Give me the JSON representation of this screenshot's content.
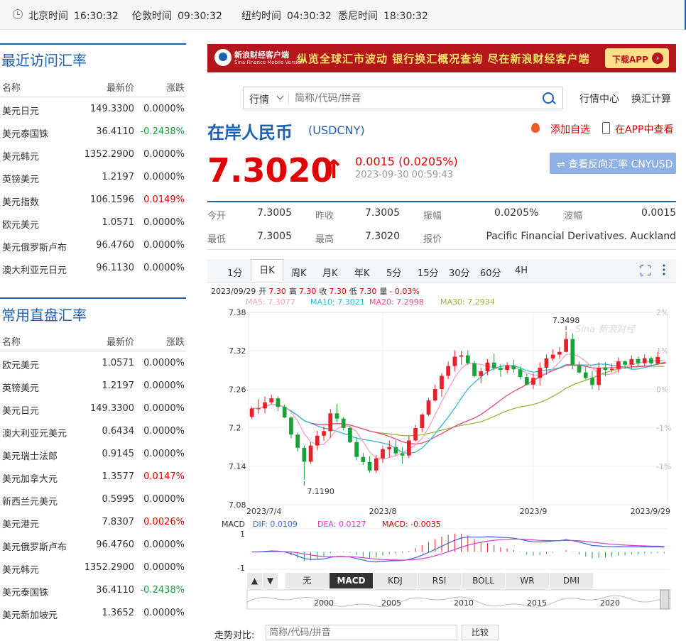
{
  "topbar": {
    "zones": [
      {
        "label": "北京时间",
        "time": "16:30:32"
      },
      {
        "label": "伦敦时间",
        "time": "09:30:32"
      },
      {
        "label": "纽约时间",
        "time": "04:30:32"
      },
      {
        "label": "悉尼时间",
        "time": "18:30:32"
      }
    ]
  },
  "recent": {
    "title": "最近访问汇率",
    "headers": [
      "名称",
      "最新价",
      "涨跌"
    ],
    "rows": [
      {
        "name": "美元日元",
        "price": "149.3300",
        "chg": "0.0000%",
        "dir": "flat"
      },
      {
        "name": "美元泰国铢",
        "price": "36.4110",
        "chg": "-0.2438%",
        "dir": "down"
      },
      {
        "name": "美元韩元",
        "price": "1352.2900",
        "chg": "0.0000%",
        "dir": "flat"
      },
      {
        "name": "英镑美元",
        "price": "1.2197",
        "chg": "0.0000%",
        "dir": "flat"
      },
      {
        "name": "美元指数",
        "price": "106.1596",
        "chg": "0.0149%",
        "dir": "up"
      },
      {
        "name": "欧元美元",
        "price": "1.0571",
        "chg": "0.0000%",
        "dir": "flat"
      },
      {
        "name": "美元俄罗斯卢布",
        "price": "96.4760",
        "chg": "0.0000%",
        "dir": "flat"
      },
      {
        "name": "澳大利亚元日元",
        "price": "96.1130",
        "chg": "0.0000%",
        "dir": "flat"
      }
    ]
  },
  "direct": {
    "title": "常用直盘汇率",
    "headers": [
      "名称",
      "最新价",
      "涨跌"
    ],
    "rows": [
      {
        "name": "欧元美元",
        "price": "1.0571",
        "chg": "0.0000%",
        "dir": "flat"
      },
      {
        "name": "英镑美元",
        "price": "1.2197",
        "chg": "0.0000%",
        "dir": "flat"
      },
      {
        "name": "美元日元",
        "price": "149.3300",
        "chg": "0.0000%",
        "dir": "flat"
      },
      {
        "name": "澳大利亚元美元",
        "price": "0.6434",
        "chg": "0.0000%",
        "dir": "flat"
      },
      {
        "name": "美元瑞士法郎",
        "price": "0.9145",
        "chg": "0.0000%",
        "dir": "flat"
      },
      {
        "name": "美元加拿大元",
        "price": "1.3577",
        "chg": "0.0147%",
        "dir": "up"
      },
      {
        "name": "新西兰元美元",
        "price": "0.5995",
        "chg": "0.0000%",
        "dir": "flat"
      },
      {
        "name": "美元港元",
        "price": "7.8307",
        "chg": "0.0026%",
        "dir": "up"
      },
      {
        "name": "美元俄罗斯卢布",
        "price": "96.4760",
        "chg": "0.0000%",
        "dir": "flat"
      },
      {
        "name": "美元韩元",
        "price": "1352.2900",
        "chg": "0.0000%",
        "dir": "flat"
      },
      {
        "name": "美元泰国铢",
        "price": "36.4110",
        "chg": "-0.2438%",
        "dir": "down"
      },
      {
        "name": "美元新加坡元",
        "price": "1.3652",
        "chg": "0.0000%",
        "dir": "flat"
      }
    ]
  },
  "banner": {
    "brand": "新浪财经客户端",
    "brand_en": "Sina Finance Mobile Version",
    "slogan": "纵览全球汇市波动 银行换汇概况查询 尽在新浪财经客户端",
    "download": "下载APP"
  },
  "search": {
    "select": "行情",
    "placeholder": "简称/代码/拼音",
    "links": [
      "行情中心",
      "换汇计算"
    ]
  },
  "quote": {
    "name": "在岸人民币",
    "code": "(USDCNY)",
    "add_watch": "添加自选",
    "view_app": "在APP中查看",
    "price": "7.3020",
    "arrow": "↑",
    "change": "0.0015 (0.0205%)",
    "time": "2023-09-30 00:59:43",
    "reverse_btn": "⇌ 查看反向汇率 CNYUSD",
    "stats": [
      {
        "k": "今开",
        "v": "7.3005"
      },
      {
        "k": "昨收",
        "v": "7.3005"
      },
      {
        "k": "振幅",
        "v": "0.0205%"
      },
      {
        "k": "波幅",
        "v": "0.0015"
      },
      {
        "k": "最低",
        "v": "7.3005"
      },
      {
        "k": "最高",
        "v": "7.3020"
      },
      {
        "k": "报价",
        "v": "Pacific Financial Derivatives. Auckland"
      }
    ]
  },
  "periods": [
    "1分",
    "日K",
    "周K",
    "月K",
    "年K",
    "5分",
    "15分",
    "30分",
    "60分",
    "4H"
  ],
  "active_period": "日K",
  "indicators": [
    "无",
    "MACD",
    "KDJ",
    "RSI",
    "BOLL",
    "WR",
    "DMI"
  ],
  "active_indicator": "MACD",
  "compare": {
    "label": "走势对比:",
    "placeholder": "简称/代码/拼音",
    "button": "比较"
  },
  "chart_data": {
    "type": "candlestick",
    "info_line": {
      "date": "2023/09/29",
      "items": [
        {
          "k": "开",
          "v": "7.30"
        },
        {
          "k": "高",
          "v": "7.30"
        },
        {
          "k": "收",
          "v": "7.30"
        },
        {
          "k": "低",
          "v": "7.30"
        },
        {
          "k": "量",
          "v": "- 0.03%"
        }
      ]
    },
    "ma": [
      {
        "name": "MA5",
        "value": "7.3077",
        "color": "#f4a0b8"
      },
      {
        "name": "MA10",
        "value": "7.3021",
        "color": "#2fb8d8"
      },
      {
        "name": "MA20",
        "value": "7.2998",
        "color": "#e8497a"
      },
      {
        "name": "MA30",
        "value": "7.2934",
        "color": "#9ab53a"
      }
    ],
    "y_ticks": [
      "7.38",
      "7.32",
      "7.26",
      "7.2",
      "7.14",
      "7.08"
    ],
    "pct_ticks": [
      "2%",
      "1%",
      "0%",
      "-1%",
      "-1%"
    ],
    "ylim": [
      7.08,
      7.38
    ],
    "x_labels": [
      {
        "label": "2023/7/4",
        "index": 0
      },
      {
        "label": "2023/8",
        "index": 20
      },
      {
        "label": "2023/9",
        "index": 43
      },
      {
        "label": "2023/9/29",
        "index": 63
      }
    ],
    "high_label": "7.3498",
    "low_label": "7.1190",
    "watermark": "Sina 新浪财经",
    "candles": [
      [
        7.2172,
        7.2322,
        7.2139,
        7.2301
      ],
      [
        7.2301,
        7.2445,
        7.2215,
        7.2301
      ],
      [
        7.2301,
        7.2489,
        7.2223,
        7.2397
      ],
      [
        7.2397,
        7.2513,
        7.237,
        7.2459
      ],
      [
        7.2459,
        7.2492,
        7.2258,
        7.2325
      ],
      [
        7.2325,
        7.2364,
        7.2149,
        7.216
      ],
      [
        7.216,
        7.218,
        7.1833,
        7.1893
      ],
      [
        7.1893,
        7.1925,
        7.1628,
        7.1687
      ],
      [
        7.1687,
        7.1728,
        7.119,
        7.147
      ],
      [
        7.147,
        7.1775,
        7.1436,
        7.1723
      ],
      [
        7.1723,
        7.1955,
        7.1651,
        7.1876
      ],
      [
        7.1876,
        7.2019,
        7.1797,
        7.1947
      ],
      [
        7.1947,
        7.2296,
        7.1837,
        7.2225
      ],
      [
        7.2225,
        7.2369,
        7.2083,
        7.2143
      ],
      [
        7.2143,
        7.2168,
        7.1958,
        7.1997
      ],
      [
        7.1997,
        7.203,
        7.1762,
        7.1776
      ],
      [
        7.1776,
        7.1856,
        7.1493,
        7.1545
      ],
      [
        7.1545,
        7.1608,
        7.142,
        7.1465
      ],
      [
        7.1465,
        7.1557,
        7.13,
        7.1334
      ],
      [
        7.1334,
        7.1577,
        7.129,
        7.1522
      ],
      [
        7.1522,
        7.172,
        7.1451,
        7.1665
      ],
      [
        7.1665,
        7.1802,
        7.1541,
        7.17
      ],
      [
        7.17,
        7.181,
        7.1561,
        7.16
      ],
      [
        7.16,
        7.1696,
        7.1439,
        7.1567
      ],
      [
        7.1567,
        7.1879,
        7.1528,
        7.1802
      ],
      [
        7.1802,
        7.2047,
        7.1786,
        7.1995
      ],
      [
        7.1995,
        7.2222,
        7.1933,
        7.2206
      ],
      [
        7.2206,
        7.2468,
        7.2183,
        7.2425
      ],
      [
        7.2425,
        7.2673,
        7.241,
        7.2604
      ],
      [
        7.2604,
        7.2853,
        7.2483,
        7.281
      ],
      [
        7.281,
        7.3032,
        7.2759,
        7.2963
      ],
      [
        7.2963,
        7.3207,
        7.2876,
        7.3109
      ],
      [
        7.3109,
        7.3198,
        7.2985,
        7.3129
      ],
      [
        7.3129,
        7.3207,
        7.2977,
        7.3007
      ],
      [
        7.3007,
        7.3044,
        7.2782,
        7.2806
      ],
      [
        7.2806,
        7.2935,
        7.2691,
        7.288
      ],
      [
        7.288,
        7.307,
        7.2818,
        7.3017
      ],
      [
        7.3017,
        7.3156,
        7.289,
        7.2932
      ],
      [
        7.2932,
        7.2996,
        7.2794,
        7.2902
      ],
      [
        7.2902,
        7.3022,
        7.2846,
        7.2974
      ],
      [
        7.2974,
        7.3059,
        7.2855,
        7.2911
      ],
      [
        7.2911,
        7.2955,
        7.2755,
        7.2792
      ],
      [
        7.2792,
        7.2838,
        7.2661,
        7.2672
      ],
      [
        7.2672,
        7.2849,
        7.2604,
        7.2778
      ],
      [
        7.2778,
        7.302,
        7.2657,
        7.2936
      ],
      [
        7.2936,
        7.3142,
        7.2828,
        7.3082
      ],
      [
        7.3082,
        7.322,
        7.3043,
        7.314
      ],
      [
        7.314,
        7.3257,
        7.3073,
        7.3183
      ],
      [
        7.3183,
        7.35,
        7.3174,
        7.3384
      ],
      [
        7.3384,
        7.3473,
        7.291,
        7.2974
      ],
      [
        7.2974,
        7.3031,
        7.2848,
        7.2863
      ],
      [
        7.2863,
        7.2945,
        7.2752,
        7.2776
      ],
      [
        7.2776,
        7.2887,
        7.26,
        7.2667
      ],
      [
        7.2667,
        7.3019,
        7.2583,
        7.2935
      ],
      [
        7.2935,
        7.3023,
        7.2804,
        7.2903
      ],
      [
        7.2903,
        7.3003,
        7.2865,
        7.2919
      ],
      [
        7.2919,
        7.3098,
        7.2856,
        7.3035
      ],
      [
        7.3035,
        7.3053,
        7.2914,
        7.2983
      ],
      [
        7.2983,
        7.3125,
        7.2914,
        7.3071
      ],
      [
        7.3071,
        7.311,
        7.2957,
        7.3007
      ],
      [
        7.3007,
        7.3146,
        7.2955,
        7.3084
      ],
      [
        7.3084,
        7.3113,
        7.2964,
        7.3005
      ],
      [
        7.3005,
        7.3185,
        7.2983,
        7.3104
      ],
      [
        7.3005,
        7.302,
        7.3005,
        7.302
      ]
    ],
    "macd": {
      "label": "MACD",
      "dif": "0.0109",
      "dea": "0.0127",
      "macd": "-0.0035",
      "y_ticks": [
        "1",
        "-1"
      ]
    },
    "navigator_years": [
      "2000",
      "2005",
      "2010",
      "2015",
      "2020"
    ]
  }
}
